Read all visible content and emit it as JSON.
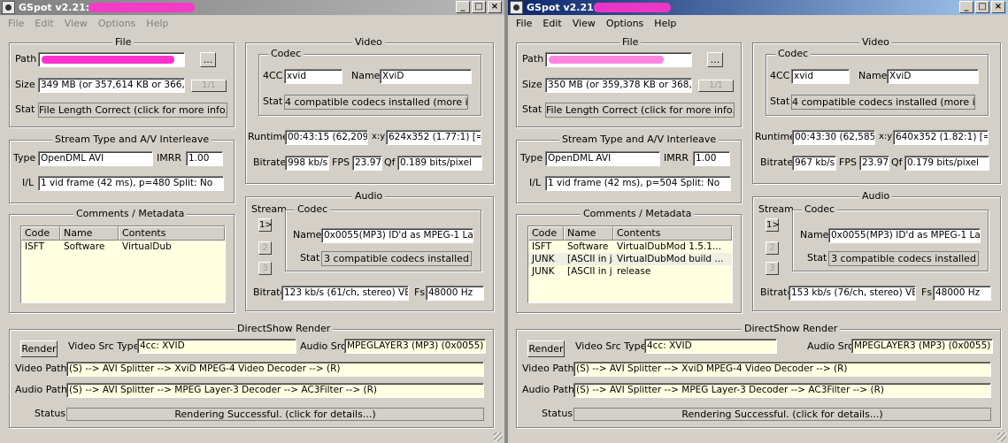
{
  "windows": [
    {
      "title": "GSpot v2.21:",
      "menu": [
        "File",
        "Edit",
        "View",
        "Options",
        "Help"
      ],
      "file": {
        "group": "File",
        "path_label": "Path",
        "browse_label": "...",
        "size_label": "Size",
        "size": "349 MB (or 357,614 KB or 366,196,",
        "part": "1/1",
        "stat_label": "Stat",
        "stat": "File Length Correct (click for more info...)"
      },
      "stream": {
        "group": "Stream Type and A/V Interleave",
        "type_label": "Type",
        "type": "OpenDML AVI",
        "imrr_label": "IMRR",
        "imrr": "1.00",
        "il_label": "I/L",
        "il": "1 vid frame (42 ms), p=480  Split: No"
      },
      "comments": {
        "group": "Comments / Metadata",
        "headers": [
          "Code",
          "Name",
          "Contents"
        ],
        "rows": [
          [
            "ISFT",
            "Software",
            "VirtualDub"
          ]
        ]
      },
      "video": {
        "group": "Video",
        "codec_group": "Codec",
        "fourcc_label": "4CC",
        "fourcc": "xvid",
        "name_label": "Name",
        "name": "XviD",
        "stat_label": "Stat",
        "stat": "4 compatible codecs installed (more info...)",
        "runtime_label": "Runtime",
        "runtime": "00:43:15 (62,209 fr",
        "xy_label": "x:y",
        "xy": "624x352 (1.77:1) [=39",
        "bitrate_label": "Bitrate",
        "bitrate": "998 kb/s",
        "fps_label": "FPS",
        "fps": "23.976",
        "qf_label": "Qf",
        "qf": "0.189 bits/pixel"
      },
      "audio": {
        "group": "Audio",
        "stream_label": "Stream",
        "codec_group": "Codec",
        "streams": [
          "1>",
          "2",
          "3"
        ],
        "name_label": "Name",
        "name": "0x0055(MP3) ID'd as MPEG-1 Laye",
        "stat_label": "Stat",
        "stat": "3 compatible codecs installed",
        "bitrate_label": "Bitrate",
        "bitrate": "123 kb/s (61/ch, stereo) VBR",
        "fs_label": "Fs",
        "fs": "48000 Hz"
      },
      "render": {
        "group": "DirectShow Render",
        "render_button": "Render",
        "video_src_label": "Video Src Type",
        "video_src": "4cc: XVID",
        "audio_src_label": "Audio Src",
        "audio_src": "MPEGLAYER3 (MP3) (0x0055)",
        "video_path_label": "Video Path",
        "video_path": "(S) --> AVI Splitter --> XviD MPEG-4 Video Decoder --> (R)",
        "audio_path_label": "Audio Path",
        "audio_path": "(S) --> AVI Splitter --> MPEG Layer-3 Decoder --> AC3Filter --> (R)",
        "status_label": "Status",
        "status": "Rendering Successful.  (click for details...)"
      }
    },
    {
      "title": "GSpot v2.21:",
      "menu": [
        "File",
        "Edit",
        "View",
        "Options",
        "Help"
      ],
      "file": {
        "group": "File",
        "path_label": "Path",
        "browse_label": "...",
        "size_label": "Size",
        "size": "350 MB (or 359,378 KB or 368,003,",
        "part": "1/1",
        "stat_label": "Stat",
        "stat": "File Length Correct (click for more info...)"
      },
      "stream": {
        "group": "Stream Type and A/V Interleave",
        "type_label": "Type",
        "type": "OpenDML AVI",
        "imrr_label": "IMRR",
        "imrr": "1.00",
        "il_label": "I/L",
        "il": "1 vid frame (42 ms), p=504  Split: No"
      },
      "comments": {
        "group": "Comments / Metadata",
        "headers": [
          "Code",
          "Name",
          "Contents"
        ],
        "rows": [
          [
            "ISFT",
            "Software",
            "VirtualDubMod 1.5.1..."
          ],
          [
            "JUNK",
            "[ASCII in j...",
            "VirtualDubMod build ..."
          ],
          [
            "JUNK",
            "[ASCII in j...",
            "release"
          ]
        ]
      },
      "video": {
        "group": "Video",
        "codec_group": "Codec",
        "fourcc_label": "4CC",
        "fourcc": "xvid",
        "name_label": "Name",
        "name": "XviD",
        "stat_label": "Stat",
        "stat": "4 compatible codecs installed (more info...)",
        "runtime_label": "Runtime",
        "runtime": "00:43:30 (62,585 fr",
        "xy_label": "x:y",
        "xy": "640x352 (1.82:1) [=20",
        "bitrate_label": "Bitrate",
        "bitrate": "967 kb/s",
        "fps_label": "FPS",
        "fps": "23.976",
        "qf_label": "Qf",
        "qf": "0.179 bits/pixel"
      },
      "audio": {
        "group": "Audio",
        "stream_label": "Stream",
        "codec_group": "Codec",
        "streams": [
          "1>",
          "2",
          "3"
        ],
        "name_label": "Name",
        "name": "0x0055(MP3) ID'd as MPEG-1 Laye",
        "stat_label": "Stat",
        "stat": "3 compatible codecs installed",
        "bitrate_label": "Bitrate",
        "bitrate": "153 kb/s (76/ch, stereo) VBR",
        "fs_label": "Fs",
        "fs": "48000 Hz"
      },
      "render": {
        "group": "DirectShow Render",
        "render_button": "Render",
        "video_src_label": "Video Src Type",
        "video_src": "4cc: XVID",
        "audio_src_label": "Audio Src",
        "audio_src": "MPEGLAYER3 (MP3) (0x0055)",
        "video_path_label": "Video Path",
        "video_path": "(S) --> AVI Splitter --> XviD MPEG-4 Video Decoder --> (R)",
        "audio_path_label": "Audio Path",
        "audio_path": "(S) --> AVI Splitter --> MPEG Layer-3 Decoder --> AC3Filter --> (R)",
        "status_label": "Status",
        "status": "Rendering Successful.  (click for details...)"
      }
    }
  ],
  "colors": {
    "window_bg": "#d4d0c8",
    "field_highlight": "#ffffe1",
    "active_title": "#0a246a",
    "inactive_title": "#808080",
    "redaction": "#ff33cc"
  }
}
